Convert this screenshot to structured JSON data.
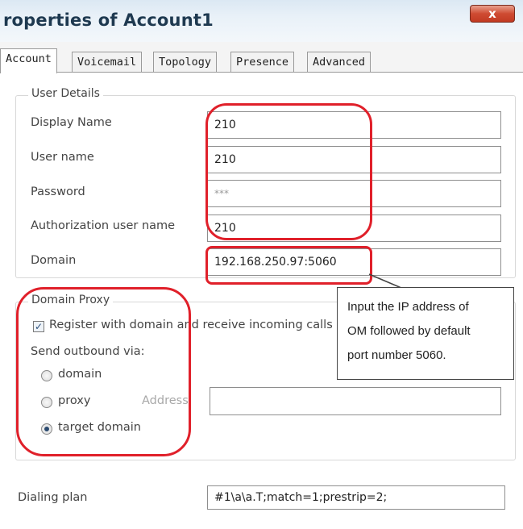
{
  "window": {
    "title": "roperties of Account1",
    "close_label": "x"
  },
  "tabs": [
    {
      "label": "Account",
      "active": true
    },
    {
      "label": "Voicemail"
    },
    {
      "label": "Topology"
    },
    {
      "label": "Presence"
    },
    {
      "label": "Advanced"
    }
  ],
  "user_details": {
    "legend": "User Details",
    "display_name": {
      "label": "Display Name",
      "value": "210"
    },
    "user_name": {
      "label": "User name",
      "value": "210"
    },
    "password": {
      "label": "Password",
      "value": "***"
    },
    "auth_user_name": {
      "label": "Authorization user name",
      "value": "210"
    },
    "domain": {
      "label": "Domain",
      "value": "192.168.250.97:5060"
    }
  },
  "domain_proxy": {
    "legend": "Domain Proxy",
    "register_label": "Register with domain and receive incoming calls",
    "register_checked": true,
    "send_outbound_label": "Send outbound via:",
    "options": [
      "domain",
      "proxy",
      "target domain"
    ],
    "selected_option": "target domain",
    "address_label": "Address",
    "address_value": ""
  },
  "dialing_plan": {
    "label": "Dialing plan",
    "value": "#1\\a\\a.T;match=1;prestrip=2;"
  },
  "callout": {
    "lines": [
      "Input the IP address of",
      "OM followed by default",
      "port number 5060."
    ]
  },
  "colors": {
    "annotation_red": "#e0202a",
    "title_text": "#1e3950"
  }
}
